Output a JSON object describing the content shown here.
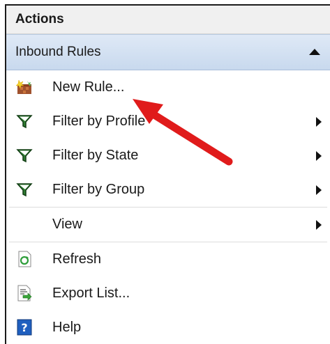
{
  "panel": {
    "title": "Actions",
    "section": "Inbound Rules",
    "items": [
      {
        "label": "New Rule...",
        "icon": "new-rule-icon",
        "submenu": false
      },
      {
        "label": "Filter by Profile",
        "icon": "filter-icon",
        "submenu": true
      },
      {
        "label": "Filter by State",
        "icon": "filter-icon",
        "submenu": true
      },
      {
        "label": "Filter by Group",
        "icon": "filter-icon",
        "submenu": true
      },
      {
        "label": "View",
        "icon": "",
        "submenu": true
      },
      {
        "label": "Refresh",
        "icon": "refresh-icon",
        "submenu": false
      },
      {
        "label": "Export List...",
        "icon": "export-list-icon",
        "submenu": false
      },
      {
        "label": "Help",
        "icon": "help-icon",
        "submenu": false
      }
    ]
  },
  "colors": {
    "section_bg": "#c8d9ee",
    "annotation_arrow": "#e01b1b"
  }
}
